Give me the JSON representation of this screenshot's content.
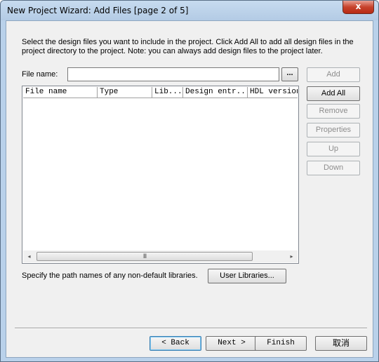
{
  "window": {
    "title": "New Project Wizard: Add Files [page 2 of 5]",
    "close_glyph": "x"
  },
  "intro": {
    "line1": "Select the design files you want to include in the project. Click Add All to add all design files in the",
    "line2": "project directory to the project. Note: you can always add design files to the project later."
  },
  "file_name": {
    "label": "File name:",
    "value": "",
    "browse_label": "..."
  },
  "side_buttons": [
    {
      "label": "Add",
      "enabled": false
    },
    {
      "label": "Add All",
      "enabled": true
    },
    {
      "label": "Remove",
      "enabled": false
    },
    {
      "label": "Properties",
      "enabled": false
    },
    {
      "label": "Up",
      "enabled": false
    },
    {
      "label": "Down",
      "enabled": false
    }
  ],
  "table": {
    "columns": [
      "File name",
      "Type",
      "Lib...",
      "Design entr...",
      "HDL version"
    ],
    "rows": []
  },
  "scrollbar": {
    "left_arrow": "◂",
    "right_arrow": "▸",
    "grip": "III"
  },
  "libraries": {
    "text": "Specify the path names of any non-default libraries.",
    "button_label": "User Libraries..."
  },
  "nav": {
    "back": "< Back",
    "next": "Next >",
    "finish": "Finish",
    "cancel": "取消"
  }
}
